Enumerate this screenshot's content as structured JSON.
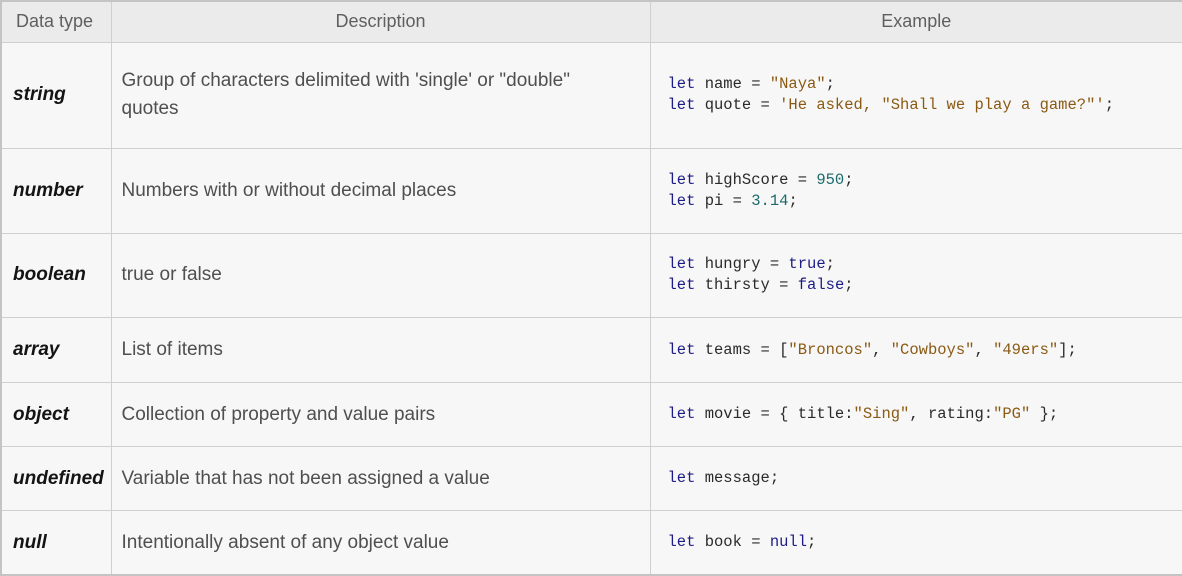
{
  "table": {
    "headers": {
      "type": "Data type",
      "description": "Description",
      "example": "Example"
    },
    "rows": [
      {
        "type": "string",
        "description": "Group of characters delimited with 'single' or \"double\" quotes",
        "code": [
          "let name = \"Naya\";",
          "let quote = 'He asked, \"Shall we play a game?\"';"
        ]
      },
      {
        "type": "number",
        "description": "Numbers with or without decimal places",
        "code": [
          "let highScore = 950;",
          "let pi = 3.14;"
        ]
      },
      {
        "type": "boolean",
        "description": "true or false",
        "code": [
          "let hungry = true;",
          "let thirsty = false;"
        ]
      },
      {
        "type": "array",
        "description": "List of items",
        "code": [
          "let teams = [\"Broncos\", \"Cowboys\", \"49ers\"];"
        ]
      },
      {
        "type": "object",
        "description": "Collection of property and value pairs",
        "code": [
          "let movie = { title:\"Sing\", rating:\"PG\" };"
        ]
      },
      {
        "type": "undefined",
        "description": "Variable that has not been assigned a value",
        "code": [
          "let message;"
        ]
      },
      {
        "type": "null",
        "description": "Intentionally absent of any object value",
        "code": [
          "let book = null;"
        ]
      }
    ]
  },
  "colors": {
    "keyword": "#1d1c87",
    "string": "#8a5a14",
    "number": "#1a6b6b",
    "header_bg": "#ebebeb",
    "cell_bg": "#f7f7f7",
    "border": "#cfcfcf"
  }
}
